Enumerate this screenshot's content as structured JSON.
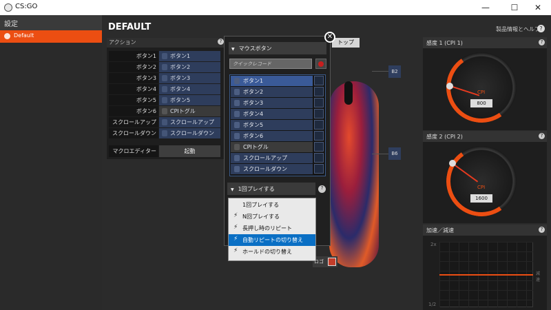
{
  "window": {
    "title": "CS:GO",
    "minimize": "—",
    "maximize": "☐",
    "close": "✕"
  },
  "sidebar": {
    "header": "設定",
    "items": [
      {
        "label": "Default"
      }
    ]
  },
  "page": {
    "title": "DEFAULT",
    "help_link": "製品情報とヘルプ",
    "help_icon": "?"
  },
  "actions": {
    "header": "アクション",
    "help": "?",
    "rows": [
      {
        "label": "ボタン1",
        "value": "ボタン1"
      },
      {
        "label": "ボタン2",
        "value": "ボタン2"
      },
      {
        "label": "ボタン3",
        "value": "ボタン3"
      },
      {
        "label": "ボタン4",
        "value": "ボタン4"
      },
      {
        "label": "ボタン5",
        "value": "ボタン5"
      },
      {
        "label": "ボタン6",
        "value": "CPIトグル"
      },
      {
        "label": "スクロールアップ",
        "value": "スクロールアップ"
      },
      {
        "label": "スクロールダウン",
        "value": "スクロールダウン"
      }
    ],
    "macro_label": "マクロエディター",
    "macro_button": "起動"
  },
  "mouse_view": {
    "tab_label": "トップ",
    "b2": "B2",
    "b6": "B6",
    "logo": "ロゴ"
  },
  "popup": {
    "close": "✕",
    "header": "マウスボタン",
    "quick_record_placeholder": "クイックレコード",
    "buttons": [
      "ボタン1",
      "ボタン2",
      "ボタン3",
      "ボタン4",
      "ボタン5",
      "ボタン6",
      "CPIトグル",
      "スクロールアップ",
      "スクロールダウン"
    ],
    "play_mode": "1回プレイする",
    "play_help": "?",
    "play_options": [
      {
        "label": "1回プレイする",
        "bolt": false
      },
      {
        "label": "N回プレイする",
        "bolt": true
      },
      {
        "label": "長押し時のリピート",
        "bolt": true
      },
      {
        "label": "自動リピートの切り替え",
        "bolt": true,
        "selected": true
      },
      {
        "label": "ホールドの切り替え",
        "bolt": true
      }
    ]
  },
  "sensitivity": {
    "cpi1": {
      "title": "感度 1 (CPI 1)",
      "unit": "CPI",
      "value": "800",
      "help": "?"
    },
    "cpi2": {
      "title": "感度 2 (CPI 2)",
      "unit": "CPI",
      "value": "1600",
      "help": "?"
    }
  },
  "acceleration": {
    "title": "加速／減速",
    "top_label": "2x",
    "bottom_label": "1/2",
    "side_label": "減速",
    "help": "?"
  }
}
